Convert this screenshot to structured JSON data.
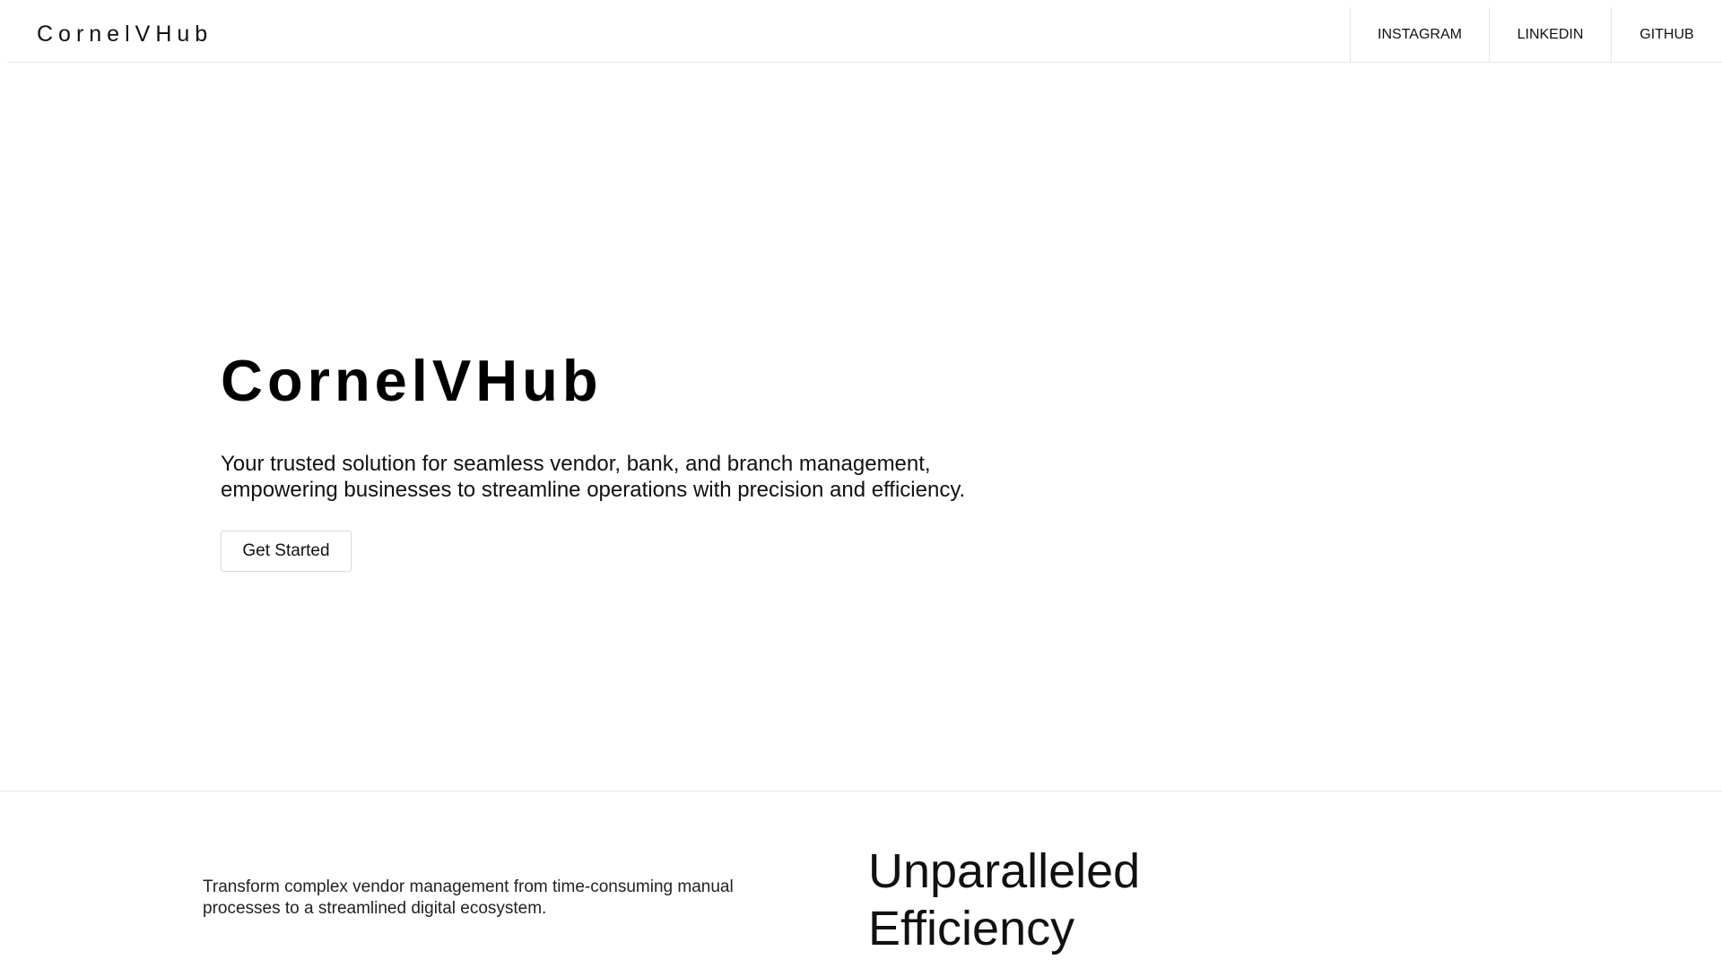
{
  "header": {
    "brand": "CornelVHub",
    "nav": [
      {
        "label": "INSTAGRAM"
      },
      {
        "label": "LINKEDIN"
      },
      {
        "label": "GITHUB"
      }
    ]
  },
  "hero": {
    "title": "CornelVHub",
    "subtitle_line1": "Your trusted solution for seamless vendor, bank, and branch management,",
    "subtitle_line2": "empowering businesses to streamline operations with precision and efficiency.",
    "cta_label": "Get Started"
  },
  "feature": {
    "description_line1": "Transform complex vendor management from time-consuming manual",
    "description_line2": "processes to a streamlined digital ecosystem.",
    "heading_line1": "Unparalleled",
    "heading_line2": "Efficiency"
  }
}
